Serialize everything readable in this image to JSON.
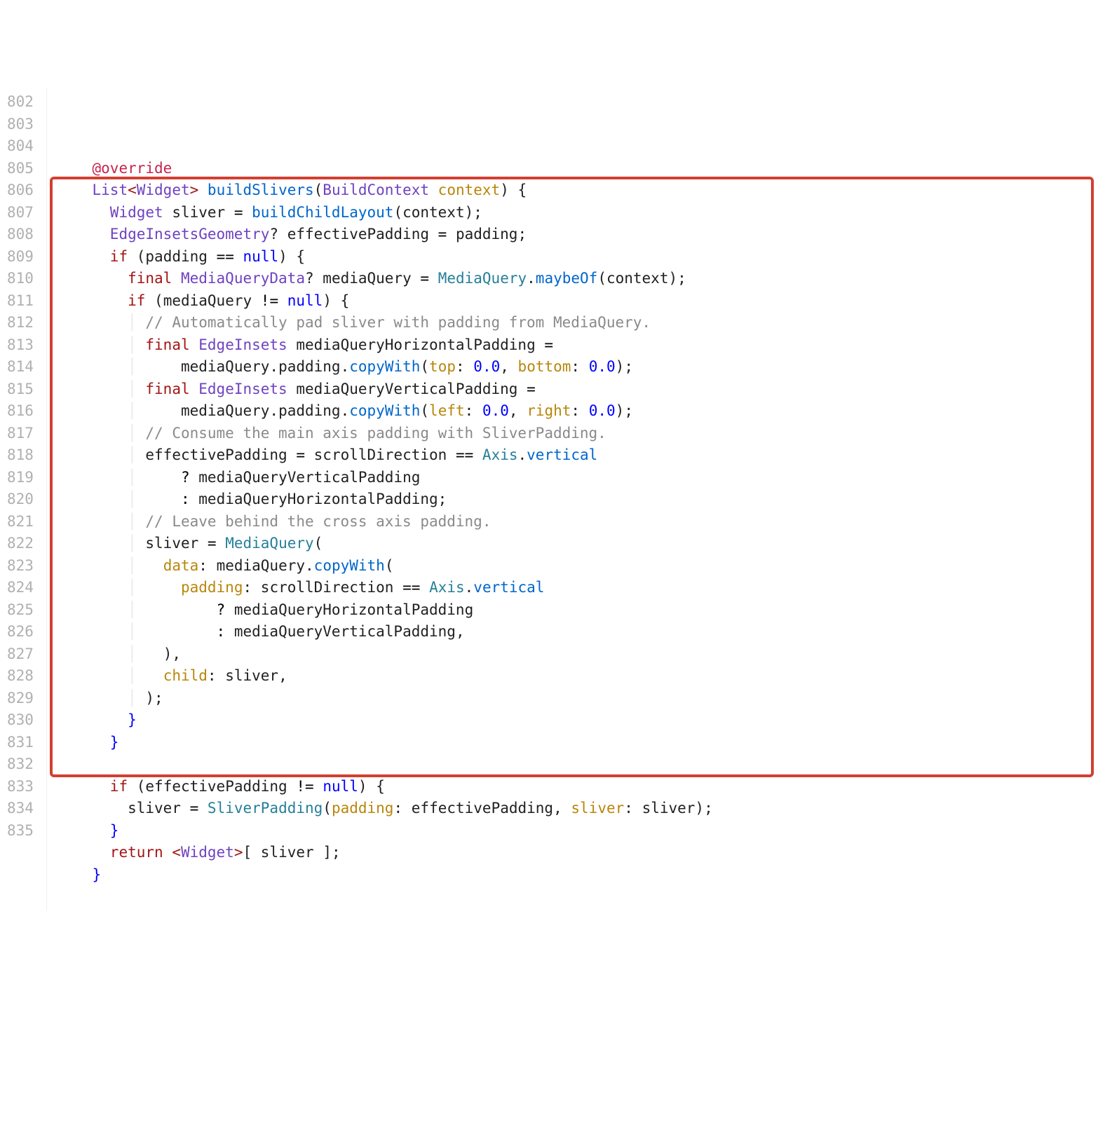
{
  "startLine": 802,
  "numLines": 34,
  "highlight": {
    "fromLine": 806,
    "toLine": 832
  },
  "tokens": {
    "override": "@override",
    "listType": "List",
    "widgetType": "Widget",
    "buildSlivers": "buildSlivers",
    "buildContext": "BuildContext",
    "context": "context",
    "sliver": "sliver",
    "buildChildLayout": "buildChildLayout",
    "edgeInsetsGeometry": "EdgeInsetsGeometry",
    "effectivePadding": "effectivePadding",
    "padding": "padding",
    "ifKw": "if",
    "nullKw": "null",
    "finalKw": "final",
    "mediaQueryData": "MediaQueryData",
    "mediaQuery": "mediaQuery",
    "mediaQueryClass": "MediaQuery",
    "maybeOf": "maybeOf",
    "comment1": "// Automatically pad sliver with padding from MediaQuery.",
    "edgeInsets": "EdgeInsets",
    "mqHPad": "mediaQueryHorizontalPadding",
    "mqVPad": "mediaQueryVerticalPadding",
    "copyWith": "copyWith",
    "top": "top",
    "bottom": "bottom",
    "left": "left",
    "right": "right",
    "zero": "0.0",
    "comment2": "// Consume the main axis padding with SliverPadding.",
    "scrollDirection": "scrollDirection",
    "axis": "Axis",
    "vertical": "vertical",
    "comment3": "// Leave behind the cross axis padding.",
    "data": "data",
    "paddingNamed": "padding",
    "child": "child",
    "sliverPadding": "SliverPadding",
    "sliverNamed": "sliver",
    "returnKw": "return",
    "eq": "=",
    "eqeq": "==",
    "neq": "!=",
    "lt": "<",
    "gt": ">",
    "q": "?",
    "colon": ":",
    "comma": ",",
    "semi": ";",
    "lparen": "(",
    "rparen": ")",
    "lbrace": "{",
    "rbrace": "}",
    "lbrack": "[",
    "rbrack": "]",
    "dot": "."
  }
}
